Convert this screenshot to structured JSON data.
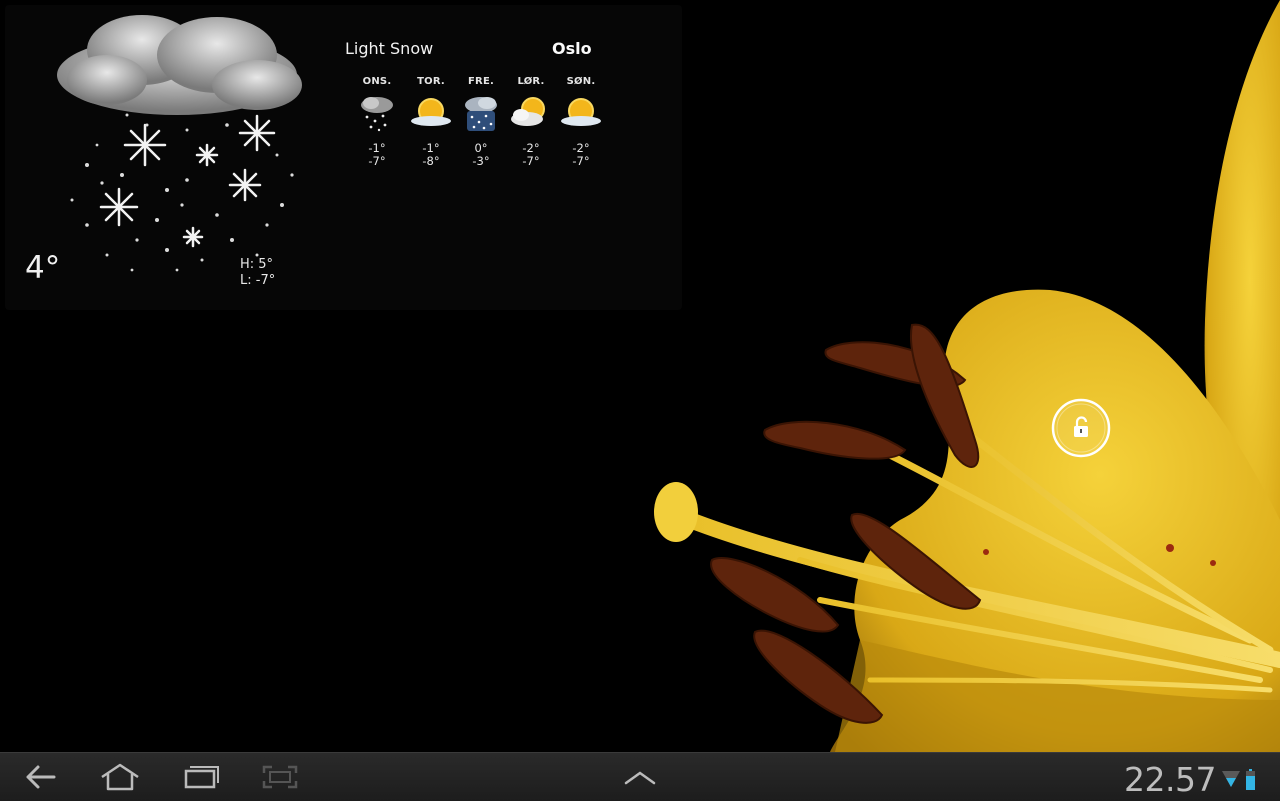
{
  "weather": {
    "current_temp": "4°",
    "high": "H: 5°",
    "low": "L: -7°",
    "condition": "Light Snow",
    "city": "Oslo",
    "forecast": [
      {
        "day": "ONS.",
        "hi": "-1°",
        "lo": "-7°",
        "icon": "snow-icon"
      },
      {
        "day": "TOR.",
        "hi": "-1°",
        "lo": "-8°",
        "icon": "sunny-icon"
      },
      {
        "day": "FRE.",
        "hi": "0°",
        "lo": "-3°",
        "icon": "snow-showers-icon"
      },
      {
        "day": "LØR.",
        "hi": "-2°",
        "lo": "-7°",
        "icon": "partly-cloudy-icon"
      },
      {
        "day": "SØN.",
        "hi": "-2°",
        "lo": "-7°",
        "icon": "sunny-icon"
      }
    ]
  },
  "statusbar": {
    "clock": "22.57"
  },
  "colors": {
    "accent_unlock": "#ffffff",
    "petal": "#e8b820",
    "anther": "#6b2a10"
  }
}
